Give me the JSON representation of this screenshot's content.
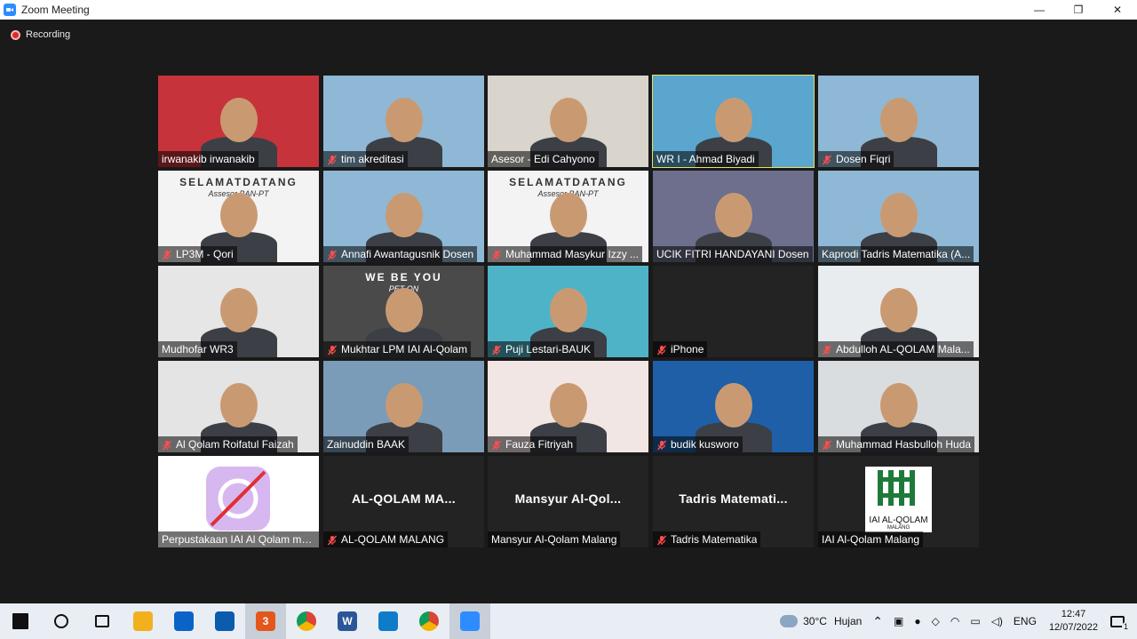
{
  "window": {
    "title": "Zoom Meeting",
    "minimize": "—",
    "maximize": "❐",
    "close": "✕"
  },
  "recording": {
    "label": "Recording",
    "color": "#e02828"
  },
  "tiles": [
    {
      "name": "irwanakib irwanakib",
      "muted": false,
      "kind": "video",
      "bg": "#c7333a"
    },
    {
      "name": "tim akreditasi",
      "muted": true,
      "kind": "video",
      "bg": "#8fb8d6"
    },
    {
      "name": "Asesor - Edi Cahyono",
      "muted": false,
      "kind": "video",
      "bg": "#d9d4cc"
    },
    {
      "name": "WR I - Ahmad Biyadi",
      "muted": false,
      "kind": "video",
      "bg": "#5aa6cf",
      "active": true
    },
    {
      "name": "Dosen Fiqri",
      "muted": true,
      "kind": "video",
      "bg": "#8fb8d6"
    },
    {
      "name": "LP3M - Qori",
      "muted": true,
      "kind": "video",
      "bg": "#f3f3f3",
      "banner": "SELAMATDATANG",
      "banner_sub": "Assesor BAN-PT"
    },
    {
      "name": "Annafi Awantagusnik Dosen",
      "muted": true,
      "kind": "video",
      "bg": "#8fb8d6"
    },
    {
      "name": "Muhammad Masykur Izzy ...",
      "muted": true,
      "kind": "video",
      "bg": "#f3f3f3",
      "banner": "SELAMATDATANG",
      "banner_sub": "Assesor BAN-PT"
    },
    {
      "name": "UCIK FITRI HANDAYANI Dosen",
      "muted": false,
      "kind": "video",
      "bg": "#6d6f8c"
    },
    {
      "name": "Kaprodi Tadris Matematika (A...",
      "muted": false,
      "kind": "video",
      "bg": "#8fb8d6"
    },
    {
      "name": "Mudhofar WR3",
      "muted": false,
      "kind": "video",
      "bg": "#e6e6e6"
    },
    {
      "name": "Mukhtar LPM IAI Al-Qolam",
      "muted": true,
      "kind": "video",
      "bg": "#4a4a4a",
      "banner": "WE BE   YOU",
      "banner_sub": "PET   ON"
    },
    {
      "name": "Puji Lestari-BAUK",
      "muted": true,
      "kind": "video",
      "bg": "#4fb3c8"
    },
    {
      "name": "iPhone",
      "muted": true,
      "kind": "empty",
      "bg": "#232323"
    },
    {
      "name": "Abdulloh AL-QOLAM Mala...",
      "muted": true,
      "kind": "video",
      "bg": "#e9ecef"
    },
    {
      "name": "Al Qolam Roifatul Faizah",
      "muted": true,
      "kind": "video",
      "bg": "#e4e4e4"
    },
    {
      "name": "Zainuddin BAAK",
      "muted": false,
      "kind": "video",
      "bg": "#7a9cb8"
    },
    {
      "name": "Fauza Fitriyah",
      "muted": true,
      "kind": "video",
      "bg": "#f1e6e4"
    },
    {
      "name": "budik kusworo",
      "muted": true,
      "kind": "video",
      "bg": "#1f5fa8"
    },
    {
      "name": "Muhammad Hasbulloh Huda",
      "muted": true,
      "kind": "video",
      "bg": "#d9dde0"
    },
    {
      "name": "Perpustakaan IAI Al Qolam ma...",
      "muted": false,
      "kind": "avatar",
      "bg": "#ffffff"
    },
    {
      "name": "AL-QOLAM MALANG",
      "muted": true,
      "kind": "text",
      "center": "AL-QOLAM  MA...",
      "bg": "#232323"
    },
    {
      "name": "Mansyur Al-Qolam Malang",
      "muted": false,
      "kind": "text",
      "center": "Mansyur  Al-Qol...",
      "bg": "#232323"
    },
    {
      "name": "Tadris Matematika",
      "muted": true,
      "kind": "text",
      "center": "Tadris  Matemati...",
      "bg": "#232323"
    },
    {
      "name": "IAI Al-Qolam Malang",
      "muted": false,
      "kind": "logo",
      "logo_text": "IAI AL-QOLAM",
      "logo_sub": "MALANG",
      "bg": "#232323"
    }
  ],
  "taskbar": {
    "apps": [
      {
        "icon": "windows-start-icon",
        "label": ""
      },
      {
        "icon": "search-icon",
        "label": ""
      },
      {
        "icon": "task-view-icon",
        "label": ""
      },
      {
        "icon": "file-explorer-icon",
        "label": ""
      },
      {
        "icon": "mail-icon",
        "label": ""
      },
      {
        "icon": "store-icon",
        "label": ""
      },
      {
        "icon": "telegram-icon",
        "label": "3"
      },
      {
        "icon": "chrome-icon",
        "label": ""
      },
      {
        "icon": "word-icon",
        "label": "W"
      },
      {
        "icon": "edge-icon",
        "label": ""
      },
      {
        "icon": "chrome-profile-icon",
        "label": ""
      },
      {
        "icon": "zoom-icon",
        "label": ""
      }
    ],
    "weather": {
      "temp": "30°C",
      "desc": "Hujan"
    },
    "language": "ENG",
    "time": "12:47",
    "date": "12/07/2022",
    "notifications": "1"
  }
}
